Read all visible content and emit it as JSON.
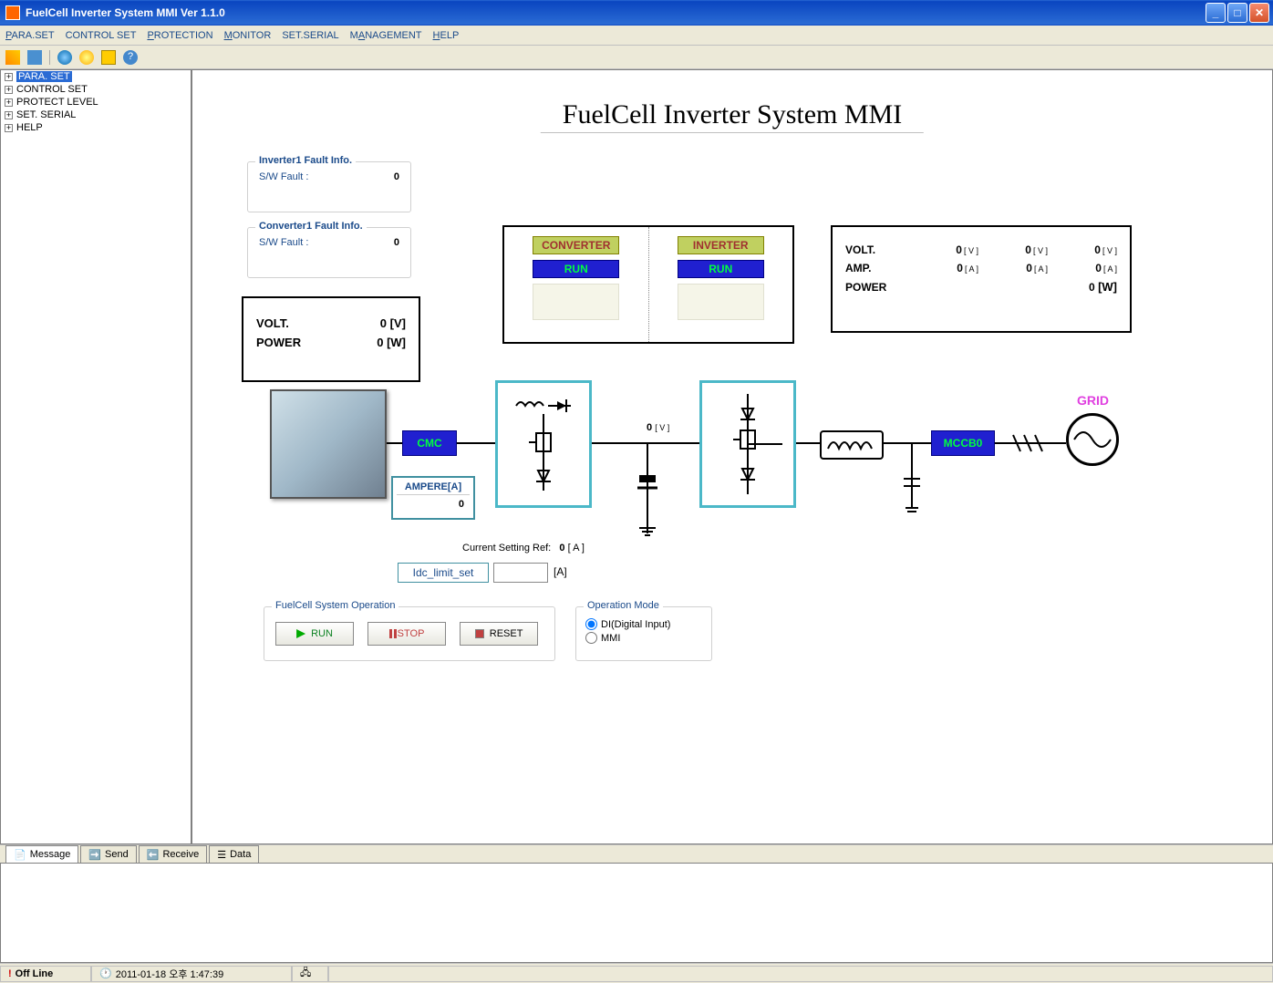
{
  "window": {
    "title": "FuelCell Inverter System MMI Ver 1.1.0"
  },
  "menu": {
    "paraset": "PARA.SET",
    "controlset": "CONTROL SET",
    "protection": "PROTECTION",
    "monitor": "MONITOR",
    "setserial": "SET.SERIAL",
    "management": "MANAGEMENT",
    "help": "HELP"
  },
  "tree": {
    "items": [
      {
        "label": "PARA. SET",
        "selected": true
      },
      {
        "label": "CONTROL SET"
      },
      {
        "label": "PROTECT LEVEL"
      },
      {
        "label": "SET. SERIAL"
      },
      {
        "label": "HELP"
      }
    ]
  },
  "page": {
    "title": "FuelCell Inverter System MMI"
  },
  "fault": {
    "inv": {
      "title": "Inverter1 Fault Info.",
      "sw_label": "S/W Fault :",
      "sw_value": "0"
    },
    "conv": {
      "title": "Converter1 Fault Info.",
      "sw_label": "S/W Fault :",
      "sw_value": "0"
    }
  },
  "vp": {
    "volt_label": "VOLT.",
    "volt_value": "0",
    "volt_unit": "[V]",
    "power_label": "POWER",
    "power_value": "0",
    "power_unit": "[W]"
  },
  "ci": {
    "conv_label": "CONVERTER",
    "inv_label": "INVERTER",
    "run_label": "RUN"
  },
  "metrics": {
    "volt_label": "VOLT.",
    "amp_label": "AMP.",
    "power_label": "POWER",
    "v1": "0",
    "v2": "0",
    "v3": "0",
    "a1": "0",
    "a2": "0",
    "a3": "0",
    "p": "0",
    "u_v": "[ V ]",
    "u_a": "[ A ]",
    "u_w": "[W]"
  },
  "circuit": {
    "cmc": "CMC",
    "amp_title": "AMPERE[A]",
    "amp_value": "0",
    "dcv": "0",
    "dcv_unit": "[ V ]",
    "mccb": "MCCB0",
    "grid": "GRID"
  },
  "setting": {
    "curset_label": "Current Setting Ref:",
    "curset_value": "0",
    "curset_unit": "[ A ]",
    "idc_label": "Idc_limit_set",
    "idc_unit": "[A]"
  },
  "ops": {
    "group_label": "FuelCell System Operation",
    "run": "RUN",
    "stop": "STOP",
    "reset": "RESET"
  },
  "mode": {
    "group_label": "Operation Mode",
    "di": "DI(Digital Input)",
    "mmi": "MMI"
  },
  "bottomtabs": {
    "message": "Message",
    "send": "Send",
    "receive": "Receive",
    "data": "Data"
  },
  "status": {
    "offline": "Off Line",
    "datetime": "2011-01-18 오후 1:47:39"
  }
}
